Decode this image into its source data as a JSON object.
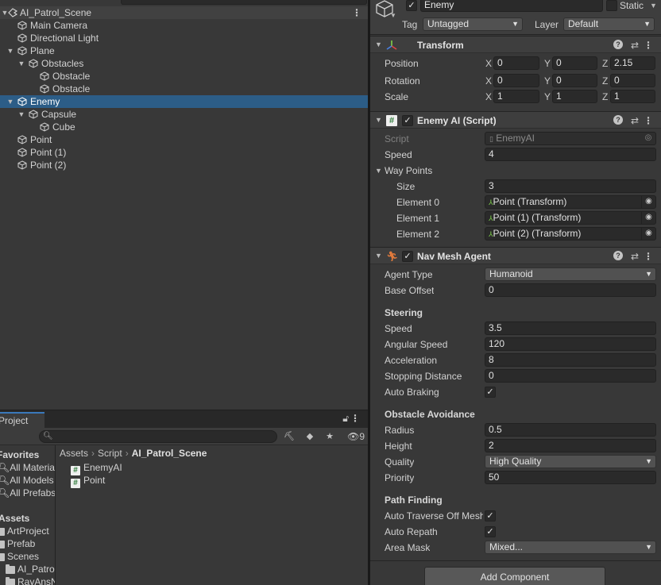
{
  "hierarchy": {
    "scene": "AI_Patrol_Scene",
    "items": [
      {
        "label": "Main Camera"
      },
      {
        "label": "Directional Light"
      },
      {
        "label": "Plane"
      },
      {
        "label": "Obstacles"
      },
      {
        "label": "Obstacle"
      },
      {
        "label": "Obstacle"
      },
      {
        "label": "Enemy"
      },
      {
        "label": "Capsule"
      },
      {
        "label": "Cube"
      },
      {
        "label": "Point"
      },
      {
        "label": "Point (1)"
      },
      {
        "label": "Point (2)"
      }
    ]
  },
  "project": {
    "tab_label": "Project",
    "hidden_count": "9",
    "favorites_title": "Favorites",
    "favorites": [
      "All Materials",
      "All Models",
      "All Prefabs"
    ],
    "assets_title": "Assets",
    "folders": [
      "ArtProject",
      "Prefab",
      "Scenes",
      "AI_Patrol",
      "RayAnsN"
    ],
    "breadcrumb": [
      "Assets",
      "Script",
      "AI_Patrol_Scene"
    ],
    "assets": [
      {
        "label": "EnemyAI"
      },
      {
        "label": "Point"
      }
    ]
  },
  "inspector": {
    "object_name": "Enemy",
    "static_label": "Static",
    "tag_label": "Tag",
    "tag_value": "Untagged",
    "layer_label": "Layer",
    "layer_value": "Default",
    "transform": {
      "title": "Transform",
      "position_label": "Position",
      "rotation_label": "Rotation",
      "scale_label": "Scale",
      "axis_x": "X",
      "axis_y": "Y",
      "axis_z": "Z",
      "position": [
        "0",
        "0",
        "2.15"
      ],
      "rotation": [
        "0",
        "0",
        "0"
      ],
      "scale": [
        "1",
        "1",
        "1"
      ]
    },
    "enemy_ai": {
      "title": "Enemy AI (Script)",
      "script_label": "Script",
      "script_value": "EnemyAI",
      "speed_label": "Speed",
      "speed_value": "4",
      "waypoints_label": "Way Points",
      "size_label": "Size",
      "size_value": "3",
      "elements": [
        {
          "label": "Element 0",
          "value": "Point (Transform)"
        },
        {
          "label": "Element 1",
          "value": "Point (1) (Transform)"
        },
        {
          "label": "Element 2",
          "value": "Point (2) (Transform)"
        }
      ]
    },
    "nav_mesh_agent": {
      "title": "Nav Mesh Agent",
      "agent_type_label": "Agent Type",
      "agent_type_value": "Humanoid",
      "base_offset_label": "Base Offset",
      "base_offset_value": "0",
      "steering_title": "Steering",
      "speed_label": "Speed",
      "speed_value": "3.5",
      "angular_speed_label": "Angular Speed",
      "angular_speed_value": "120",
      "acceleration_label": "Acceleration",
      "acceleration_value": "8",
      "stopping_distance_label": "Stopping Distance",
      "stopping_distance_value": "0",
      "auto_braking_label": "Auto Braking",
      "obstacle_title": "Obstacle Avoidance",
      "radius_label": "Radius",
      "radius_value": "0.5",
      "height_label": "Height",
      "height_value": "2",
      "quality_label": "Quality",
      "quality_value": "High Quality",
      "priority_label": "Priority",
      "priority_value": "50",
      "path_title": "Path Finding",
      "auto_traverse_label": "Auto Traverse Off Mesh Link",
      "auto_repath_label": "Auto Repath",
      "area_mask_label": "Area Mask",
      "area_mask_value": "Mixed..."
    },
    "add_component_label": "Add Component"
  },
  "colors": {
    "selection": "#2c5d87",
    "panel": "#383838",
    "field": "#2a2a2a",
    "tab_accent": "#3a79bb"
  }
}
